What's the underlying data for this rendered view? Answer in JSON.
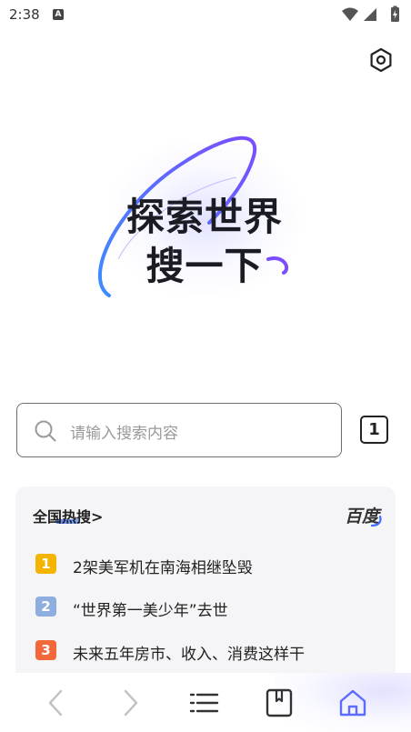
{
  "status_bar": {
    "time": "2:38",
    "notification_icon_letter": "A",
    "icons": [
      "wifi-icon",
      "signal-icon",
      "battery-charging-icon"
    ]
  },
  "settings": {
    "icon": "settings-hexagon-icon"
  },
  "hero": {
    "line1": "探索世界",
    "line2": "搜一下",
    "accent_colors": [
      "#7b4dff",
      "#3b8dff"
    ]
  },
  "search": {
    "placeholder": "请输入搜索内容",
    "icon": "search-icon",
    "tab_count": "1"
  },
  "hot": {
    "header": "全国热搜>",
    "brand": "百度",
    "items": [
      {
        "rank": "1",
        "text": "2架美军机在南海相继坠毁",
        "rank_color": "#f5b400"
      },
      {
        "rank": "2",
        "text": "“世界第一美少年”去世",
        "rank_color": "#8faee0"
      },
      {
        "rank": "3",
        "text": "未来五年房市、收入、消费这样干",
        "rank_color": "#f2683a"
      }
    ]
  },
  "bottom_nav": {
    "items": [
      {
        "icon": "back-chevron-icon"
      },
      {
        "icon": "forward-chevron-icon"
      },
      {
        "icon": "menu-icon"
      },
      {
        "icon": "bookmark-icon"
      },
      {
        "icon": "home-icon",
        "active": true
      }
    ],
    "active_color": "#5b6cff"
  }
}
